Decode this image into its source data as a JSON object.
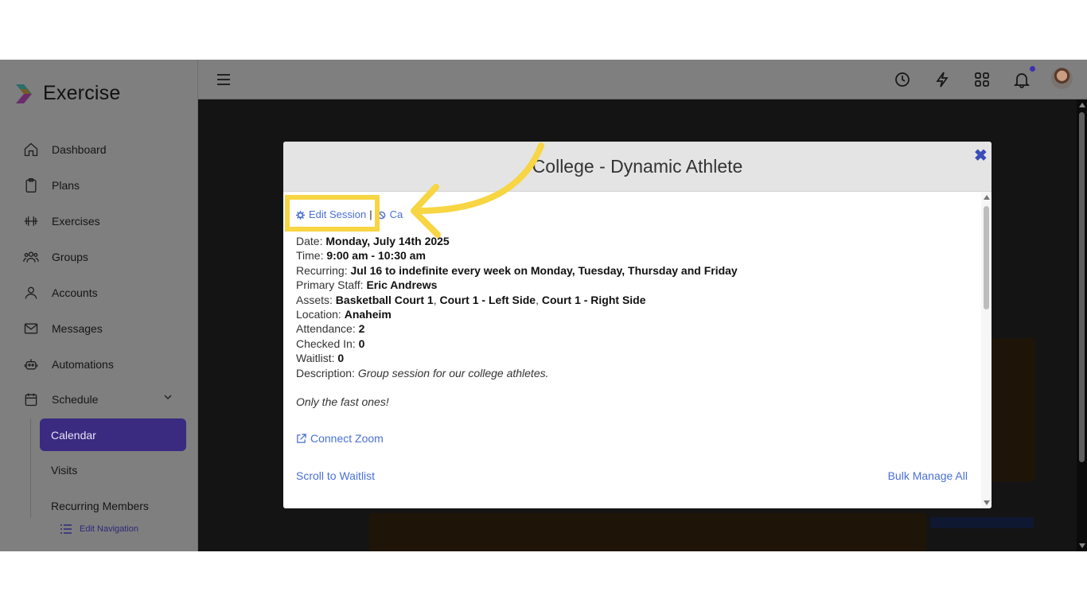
{
  "app": {
    "name": "Exercise"
  },
  "sidebar": {
    "items": [
      {
        "label": "Dashboard",
        "icon": "home-icon"
      },
      {
        "label": "Plans",
        "icon": "clipboard-icon"
      },
      {
        "label": "Exercises",
        "icon": "dumbbell-icon"
      },
      {
        "label": "Groups",
        "icon": "users-icon"
      },
      {
        "label": "Accounts",
        "icon": "user-icon"
      },
      {
        "label": "Messages",
        "icon": "mail-icon"
      },
      {
        "label": "Automations",
        "icon": "robot-icon"
      },
      {
        "label": "Schedule",
        "icon": "calendar-icon"
      }
    ],
    "schedule_sub": [
      "Calendar",
      "Visits",
      "Recurring Members"
    ],
    "active_sub": "Calendar",
    "edit_navigation": "Edit Navigation"
  },
  "topbar": {
    "icons": [
      "menu-icon",
      "clock-icon",
      "bolt-icon",
      "grid-icon",
      "bell-icon",
      "avatar"
    ]
  },
  "modal": {
    "title": "College - Dynamic Athlete",
    "actions": {
      "edit_label": "Edit Session",
      "separator": "|",
      "cancel_label": "Ca"
    },
    "details": {
      "date_label": "Date:",
      "date_value": "Monday, July 14th 2025",
      "time_label": "Time:",
      "time_value": "9:00 am - 10:30 am",
      "recurring_label": "Recurring:",
      "recurring_value": "Jul 16 to indefinite every week on Monday, Tuesday, Thursday and Friday",
      "staff_label": "Primary Staff:",
      "staff_value": "Eric Andrews",
      "assets_label": "Assets:",
      "asset_1": "Basketball Court 1",
      "asset_2": "Court 1 - Left Side",
      "asset_3": "Court 1 - Right Side",
      "location_label": "Location:",
      "location_value": "Anaheim",
      "attendance_label": "Attendance:",
      "attendance_value": "2",
      "checked_label": "Checked In:",
      "checked_value": "0",
      "waitlist_label": "Waitlist:",
      "waitlist_value": "0",
      "description_label": "Description:",
      "description_1": "Group session for our college athletes.",
      "description_2": "Only the fast ones!"
    },
    "zoom_link": "Connect Zoom",
    "scroll_waitlist": "Scroll to Waitlist",
    "bulk_manage": "Bulk Manage All"
  },
  "colors": {
    "highlight": "#f7d543",
    "accent": "#5b3fd8",
    "link": "#4a6fd8"
  }
}
